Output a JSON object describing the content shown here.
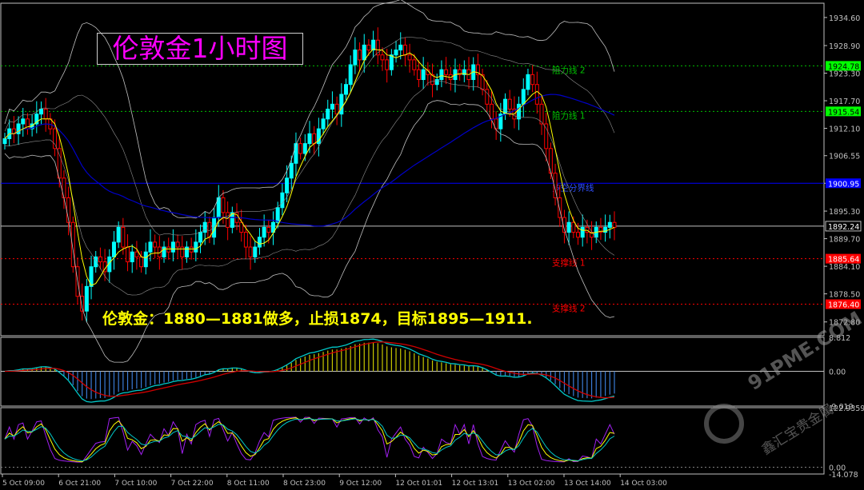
{
  "chart_data": {
    "type": "candlestick",
    "title": "伦敦金1小时图",
    "strategy_text": "伦敦金：1880—1881做多，止损1874，目标1895—1911.",
    "y_axis": {
      "ticks": [
        "1934.60",
        "1928.90",
        "1923.30",
        "1917.70",
        "1912.10",
        "1906.55",
        "1900.95",
        "1895.30",
        "1889.70",
        "1884.10",
        "1878.50",
        "1872.80"
      ],
      "ylim": [
        1870.0,
        1937.5
      ]
    },
    "x_axis": {
      "ticks": [
        "5 Oct 09:00",
        "6 Oct 21:00",
        "7 Oct 10:00",
        "7 Oct 22:00",
        "8 Oct 11:00",
        "8 Oct 23:00",
        "9 Oct 12:00",
        "12 Oct 01:01",
        "12 Oct 13:01",
        "13 Oct 02:00",
        "13 Oct 14:00",
        "14 Oct 03:00"
      ]
    },
    "horizontal_lines": [
      {
        "label": "阻力线 2",
        "price": 1924.78,
        "price_label": "1924.78",
        "color": "#00c000",
        "style": "dotted"
      },
      {
        "label": "阻力线 1",
        "price": 1915.54,
        "price_label": "1915.54",
        "color": "#00c000",
        "style": "dotted"
      },
      {
        "label": "多空分界线",
        "price": 1900.95,
        "price_label": "1900.95",
        "color": "#0000ff",
        "style": "solid"
      },
      {
        "label": "",
        "price": 1892.24,
        "price_label": "1892.24",
        "color": "#c0c0c0",
        "style": "solid"
      },
      {
        "label": "支撑线 1",
        "price": 1885.64,
        "price_label": "1885.64",
        "color": "#ff0000",
        "style": "dotted"
      },
      {
        "label": "支撑线 2",
        "price": 1876.4,
        "price_label": "1876.40",
        "color": "#ff0000",
        "style": "dotted"
      }
    ],
    "close": [
      1910,
      1912,
      1911,
      1913,
      1914,
      1912,
      1913,
      1915,
      1916,
      1914,
      1912,
      1908,
      1902,
      1898,
      1893,
      1884,
      1878,
      1875,
      1880,
      1884,
      1886,
      1885,
      1883,
      1886,
      1889,
      1892,
      1888,
      1885,
      1887,
      1886,
      1884,
      1887,
      1889,
      1888,
      1886,
      1888,
      1887,
      1889,
      1888,
      1886,
      1888,
      1887,
      1889,
      1891,
      1893,
      1890,
      1894,
      1898,
      1895,
      1892,
      1895,
      1893,
      1891,
      1888,
      1886,
      1888,
      1890,
      1892,
      1891,
      1893,
      1896,
      1899,
      1902,
      1905,
      1909,
      1907,
      1909,
      1911,
      1909,
      1912,
      1914,
      1916,
      1917,
      1915,
      1919,
      1921,
      1925,
      1928,
      1926,
      1929,
      1928,
      1930,
      1927,
      1926,
      1924,
      1927,
      1928,
      1929,
      1927,
      1926,
      1924,
      1922,
      1924,
      1923,
      1921,
      1922,
      1924,
      1923,
      1922,
      1924,
      1923,
      1924,
      1922,
      1925,
      1923,
      1920,
      1917,
      1914,
      1912,
      1915,
      1918,
      1916,
      1914,
      1917,
      1920,
      1923,
      1921,
      1917,
      1913,
      1908,
      1903,
      1898,
      1894,
      1891,
      1893,
      1891,
      1890,
      1892,
      1891,
      1890,
      1892,
      1891,
      1892,
      1893,
      1892
    ],
    "indicators": {
      "macd": {
        "ticks": [
          "8.812",
          "0.00",
          "-9.019"
        ],
        "range": [
          -9.019,
          8.812
        ]
      },
      "oscillator": {
        "ticks": [
          "122.9359",
          "0.00",
          "-14.078"
        ],
        "range": [
          -14.078,
          122.9359
        ]
      }
    },
    "grid": false
  },
  "watermark": {
    "brand": "91PME.COM",
    "tagline": "鑫汇宝贵金属"
  },
  "colors": {
    "background": "#000000",
    "bull": "#00ffff",
    "bear": "#ff0000",
    "ma_fast": "#ffff00",
    "ma_slow": "#0000c8",
    "bands": "#c0c0c0"
  }
}
